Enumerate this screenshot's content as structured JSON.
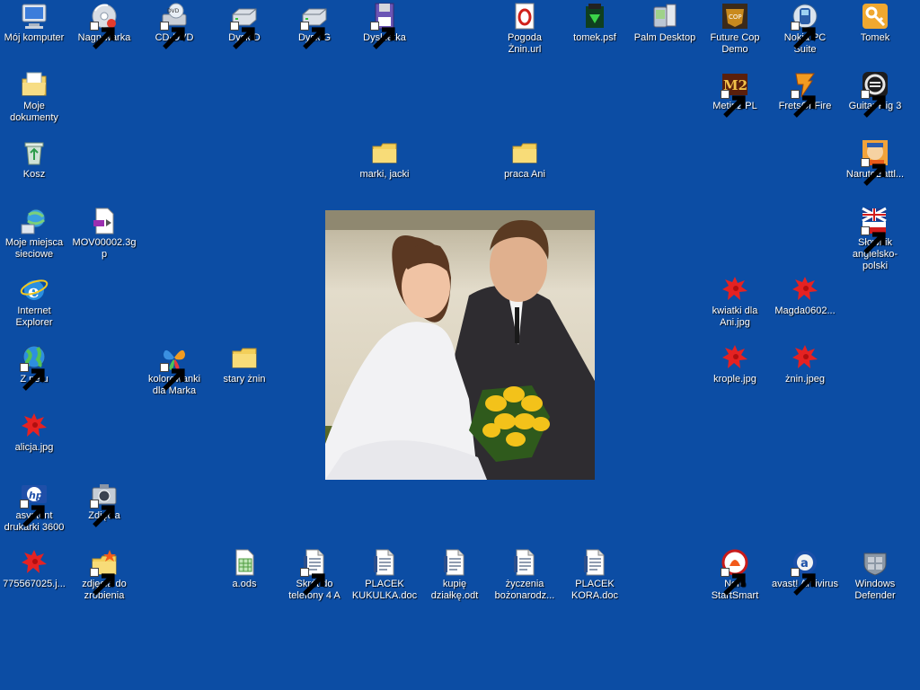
{
  "desktop": {
    "background_color": "#0c4da4",
    "photo": {
      "name": "wedding-photo",
      "colors": {
        "water": "#d9d2bf",
        "dress": "#f2f2f4",
        "suit": "#2e2c30",
        "flowers": "#f3c21a"
      }
    },
    "icons": [
      {
        "id": "moj-komputer",
        "label": "Mój komputer",
        "icon": "computer-icon",
        "shortcut": false
      },
      {
        "id": "nagrywarka",
        "label": "Nagrywarka",
        "icon": "cd-burner-icon",
        "shortcut": true
      },
      {
        "id": "cd-dvd",
        "label": "CD-DVD",
        "icon": "dvd-drive-icon",
        "shortcut": true
      },
      {
        "id": "dysk-d",
        "label": "Dysk D",
        "icon": "hard-drive-icon",
        "shortcut": true
      },
      {
        "id": "dysk-g",
        "label": "Dysk G",
        "icon": "hard-drive-icon",
        "shortcut": true
      },
      {
        "id": "dyskietka",
        "label": "Dyskietka",
        "icon": "floppy-icon",
        "shortcut": true
      },
      {
        "id": "pogoda-znin",
        "label": "Pogoda Żnin.url",
        "icon": "opera-url-icon",
        "shortcut": false
      },
      {
        "id": "tomek-psf",
        "label": "tomek.psf",
        "icon": "psf-file-icon",
        "shortcut": false
      },
      {
        "id": "palm-desktop",
        "label": "Palm Desktop",
        "icon": "palm-icon",
        "shortcut": false
      },
      {
        "id": "future-cop",
        "label": "Future Cop Demo",
        "icon": "future-cop-icon",
        "shortcut": false
      },
      {
        "id": "nokia-pc-suite",
        "label": "Nokia PC Suite",
        "icon": "nokia-icon",
        "shortcut": true
      },
      {
        "id": "tomek",
        "label": "Tomek",
        "icon": "user-key-icon",
        "shortcut": false
      },
      {
        "id": "moje-dokumenty",
        "label": "Moje dokumenty",
        "icon": "my-documents-icon",
        "shortcut": false
      },
      {
        "id": "metin2",
        "label": "Metin2 PL",
        "icon": "metin2-icon",
        "shortcut": true
      },
      {
        "id": "frets-on-fire",
        "label": "FretsOnFire",
        "icon": "frets-on-fire-icon",
        "shortcut": true
      },
      {
        "id": "guitar-rig",
        "label": "Guitar Rig 3",
        "icon": "guitar-rig-icon",
        "shortcut": true
      },
      {
        "id": "kosz",
        "label": "Kosz",
        "icon": "recycle-bin-icon",
        "shortcut": false
      },
      {
        "id": "marki-jacki",
        "label": "marki, jacki",
        "icon": "folder-icon",
        "shortcut": false
      },
      {
        "id": "praca-ani",
        "label": "praca Ani",
        "icon": "folder-icon",
        "shortcut": false
      },
      {
        "id": "naruto",
        "label": "NarutoBattl...",
        "icon": "naruto-icon",
        "shortcut": true
      },
      {
        "id": "moje-miejsca",
        "label": "Moje miejsca sieciowe",
        "icon": "network-places-icon",
        "shortcut": false
      },
      {
        "id": "mov00002",
        "label": "MOV00002.3gp",
        "icon": "video-file-icon",
        "shortcut": false
      },
      {
        "id": "slownik",
        "label": "Słownik angielsko-polski",
        "icon": "dictionary-flags-icon",
        "shortcut": true
      },
      {
        "id": "internet-explorer",
        "label": "Internet Explorer",
        "icon": "internet-explorer-icon",
        "shortcut": false
      },
      {
        "id": "kwiatki",
        "label": "kwiatki dla Ani.jpg",
        "icon": "image-file-icon",
        "shortcut": false
      },
      {
        "id": "magda",
        "label": "Magda0602...",
        "icon": "image-file-icon",
        "shortcut": false
      },
      {
        "id": "z-netu",
        "label": "Z netu",
        "icon": "globe-shortcut-icon",
        "shortcut": true
      },
      {
        "id": "kolorowanki",
        "label": "kolorowanki dla Marka",
        "icon": "msn-butterfly-icon",
        "shortcut": true
      },
      {
        "id": "stary-znin",
        "label": "stary żnin",
        "icon": "folder-icon",
        "shortcut": false
      },
      {
        "id": "krople",
        "label": "krople.jpg",
        "icon": "image-file-icon",
        "shortcut": false
      },
      {
        "id": "znin-jpeg",
        "label": "żnin.jpeg",
        "icon": "image-file-icon",
        "shortcut": false
      },
      {
        "id": "alicja",
        "label": "alicja.jpg",
        "icon": "image-file-icon",
        "shortcut": false
      },
      {
        "id": "asystent-hp",
        "label": "asystent drukarki 3600",
        "icon": "hp-icon",
        "shortcut": true
      },
      {
        "id": "zdjecia",
        "label": "Zdjęcia",
        "icon": "camera-icon",
        "shortcut": true
      },
      {
        "id": "775567025",
        "label": "775567025.j...",
        "icon": "image-file-icon",
        "shortcut": false
      },
      {
        "id": "zdjecia-do-zrobienia",
        "label": "zdjęcia do zrobienia",
        "icon": "folder-special-icon",
        "shortcut": true
      },
      {
        "id": "a-ods",
        "label": "a.ods",
        "icon": "spreadsheet-file-icon",
        "shortcut": false
      },
      {
        "id": "skrot-telefony",
        "label": "Skrót do telefony 4 A",
        "icon": "document-file-icon",
        "shortcut": true
      },
      {
        "id": "placek-kukulka",
        "label": "PLACEK KUKULKA.doc",
        "icon": "document-file-icon",
        "shortcut": false
      },
      {
        "id": "kupie-dzialke",
        "label": "kupię działkę.odt",
        "icon": "document-file-icon",
        "shortcut": false
      },
      {
        "id": "zyczenia",
        "label": "życzenia bożonarodz...",
        "icon": "document-file-icon",
        "shortcut": false
      },
      {
        "id": "placek-kora",
        "label": "PLACEK KORA.doc",
        "icon": "document-file-icon",
        "shortcut": false
      },
      {
        "id": "nero",
        "label": "Nero StartSmart",
        "icon": "nero-icon",
        "shortcut": true
      },
      {
        "id": "avast",
        "label": "avast! Antivirus",
        "icon": "avast-icon",
        "shortcut": true
      },
      {
        "id": "windows-defender",
        "label": "Windows Defender",
        "icon": "windows-defender-icon",
        "shortcut": false
      }
    ]
  }
}
